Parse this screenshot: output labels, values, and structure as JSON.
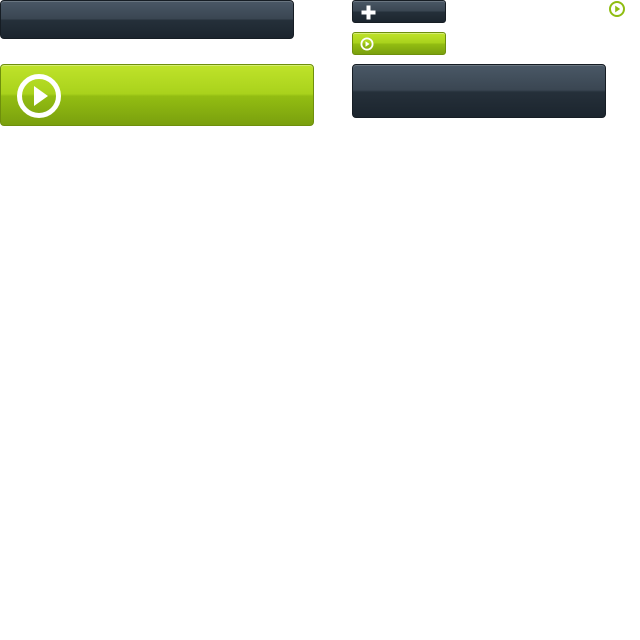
{
  "buttons": {
    "dark_wide": {
      "label": ""
    },
    "green_large": {
      "label": "",
      "icon": "play-icon"
    },
    "dark_small": {
      "label": "",
      "icon": "plus-icon"
    },
    "green_small": {
      "label": "",
      "icon": "play-icon"
    },
    "dark_medium": {
      "label": ""
    }
  },
  "standalone_icon": {
    "icon": "play-icon"
  },
  "colors": {
    "dark_top": "#4a5866",
    "dark_bottom": "#1c252e",
    "green_top": "#bfe32a",
    "green_bottom": "#7aa00e",
    "icon_white": "#ffffff",
    "icon_green": "#8fbd12"
  }
}
